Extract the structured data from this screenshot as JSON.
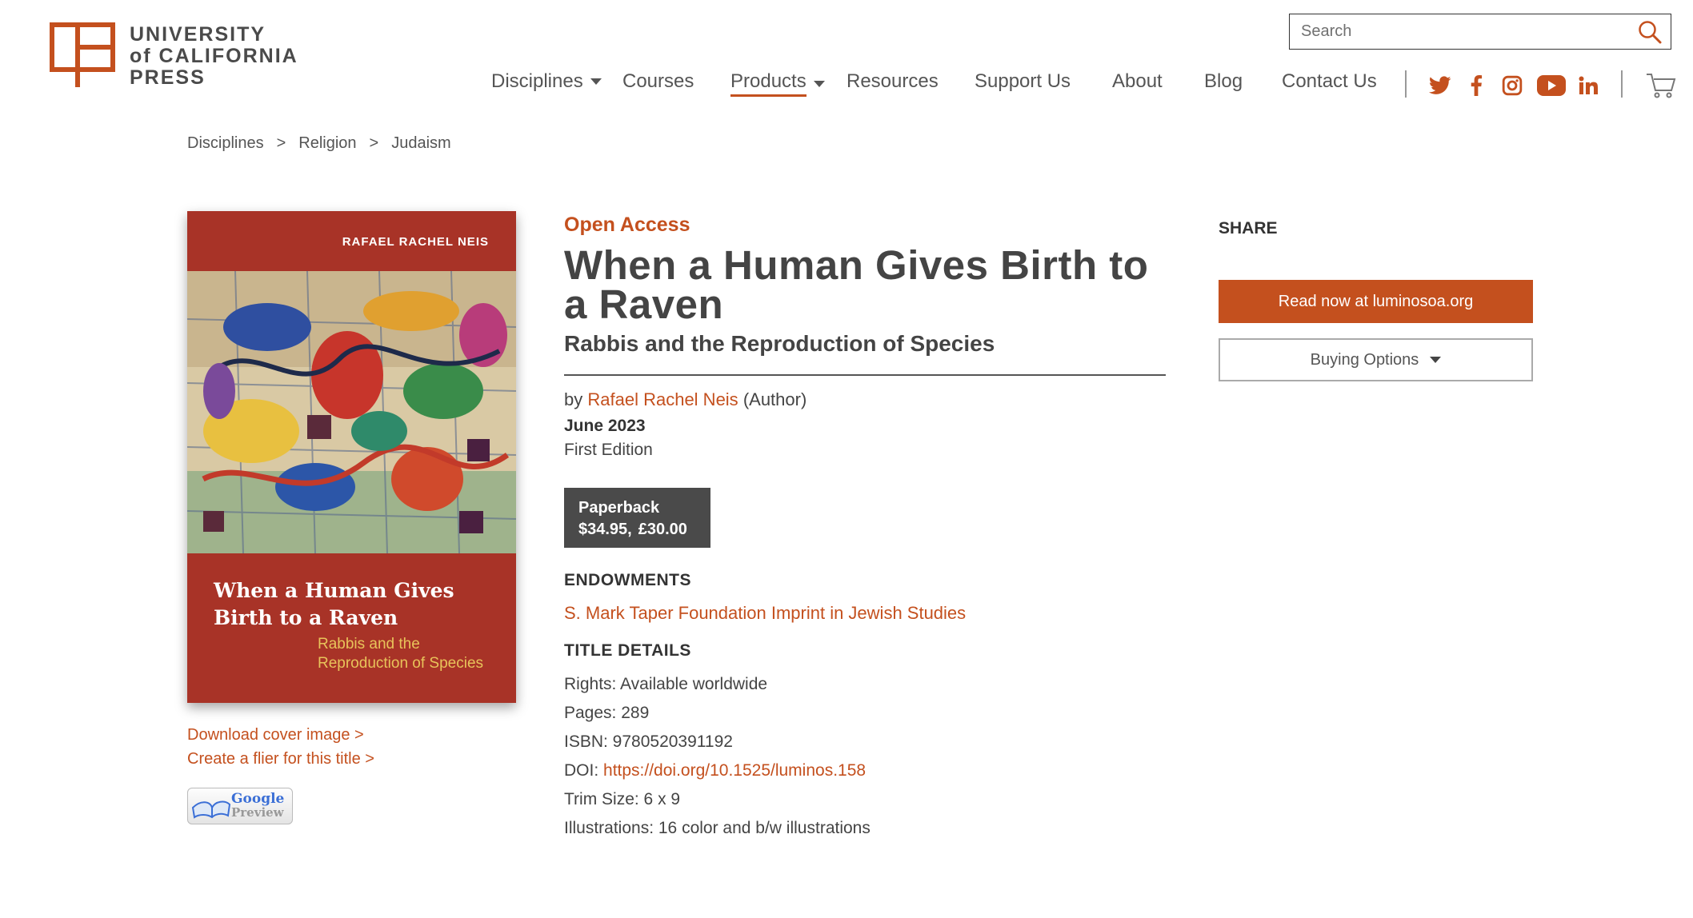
{
  "brand": {
    "line1": "UNIVERSITY",
    "line2": "of CALIFORNIA",
    "line3": "PRESS",
    "accent_color": "#c4501e"
  },
  "search": {
    "placeholder": "Search",
    "icon": "search-icon"
  },
  "nav": {
    "items": [
      {
        "label": "Disciplines",
        "has_dropdown": true
      },
      {
        "label": "Courses",
        "has_dropdown": false
      },
      {
        "label": "Products",
        "has_dropdown": true,
        "active": true
      },
      {
        "label": "Resources",
        "has_dropdown": false
      },
      {
        "label": "Support Us",
        "has_dropdown": false
      },
      {
        "label": "About",
        "has_dropdown": false
      },
      {
        "label": "Blog",
        "has_dropdown": false
      },
      {
        "label": "Contact Us",
        "has_dropdown": false
      }
    ],
    "social_icons": [
      "twitter-icon",
      "facebook-icon",
      "instagram-icon",
      "youtube-icon",
      "linkedin-icon"
    ],
    "cart_icon": "cart-icon"
  },
  "breadcrumb": {
    "items": [
      "Disciplines",
      "Religion",
      "Judaism"
    ],
    "separator": ">"
  },
  "cover": {
    "author": "RAFAEL RACHEL NEIS",
    "title": "When a Human Gives Birth to a Raven",
    "subtitle": "Rabbis and the Reproduction of Species"
  },
  "side_links": {
    "download_cover": "Download cover image >",
    "create_flier": "Create a flier for this title >",
    "google_preview_1": "Google",
    "google_preview_2": "Preview"
  },
  "book": {
    "badge": "Open Access",
    "title": "When a Human Gives Birth to a Raven",
    "subtitle": "Rabbis and the Reproduction of Species",
    "by": "by",
    "author": "Rafael Rachel Neis",
    "author_role": "(Author)",
    "date": "June 2023",
    "edition": "First Edition",
    "format": {
      "name": "Paperback",
      "price_usd": "$34.95,",
      "price_gbp": "£30.00"
    }
  },
  "endowments": {
    "heading": "ENDOWMENTS",
    "link": "S. Mark Taper Foundation Imprint in Jewish Studies"
  },
  "title_details": {
    "heading": "TITLE DETAILS",
    "rights": "Rights: Available worldwide",
    "pages": "Pages: 289",
    "isbn": "ISBN: 9780520391192",
    "doi_label": "DOI:",
    "doi_link": "https://doi.org/10.1525/luminos.158",
    "trim": "Trim Size: 6 x 9",
    "illustrations": "Illustrations: 16 color and b/w illustrations"
  },
  "share": {
    "heading": "SHARE",
    "read_now": "Read now at luminosoa.org",
    "buying_options": "Buying Options"
  }
}
